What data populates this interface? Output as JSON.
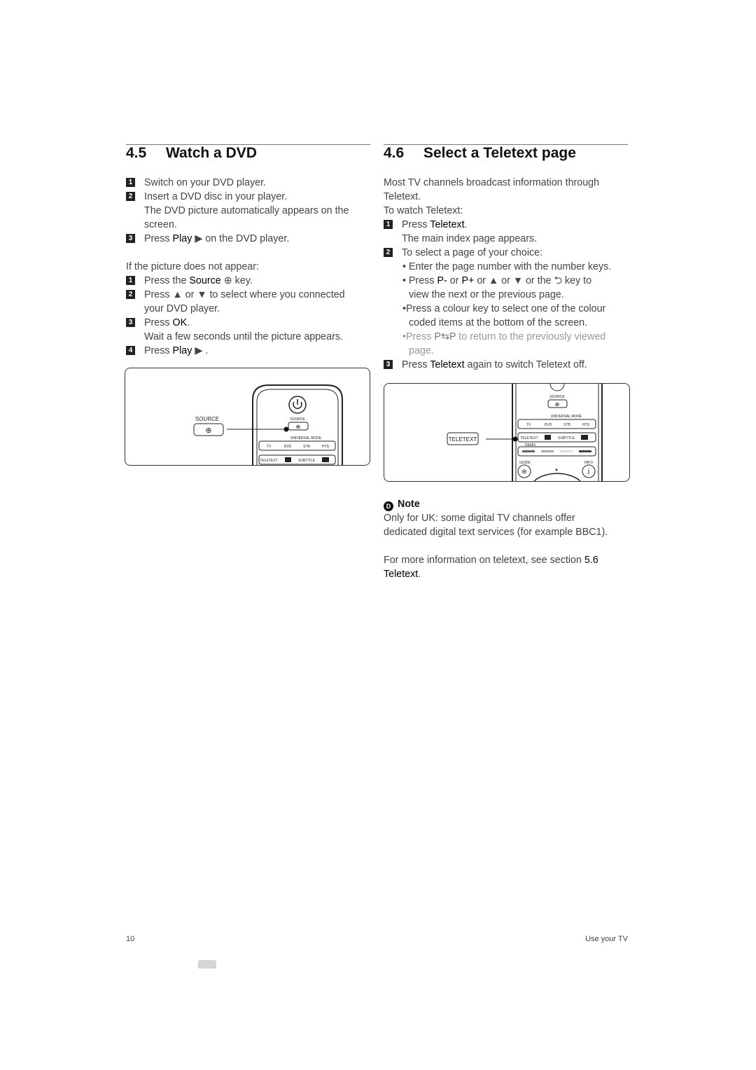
{
  "left": {
    "heading_num": "4.5",
    "heading": "Watch a DVD",
    "s1": "Switch on your DVD player.",
    "s2": "Insert a DVD disc in your player.",
    "s2b": "The DVD picture automatically appears on the",
    "s2c": "screen.",
    "s3a": "Press ",
    "s3b": "Play",
    "s3c": "▶ on the DVD player.",
    "intro": "If the picture does not appear:",
    "t1a": "Press the ",
    "t1b": "Source",
    "t1c": "⊕ key.",
    "t2": "Press ▲ or ▼ to select where you connected",
    "t2b": "your DVD player.",
    "t3a": "Press ",
    "t3b": "OK",
    ".": ".",
    "t3c": "Wait a few seconds until the picture appears.",
    "t4a": "Press ",
    "t4b": "Play",
    "t4c": "▶ .",
    "figure": {
      "source": "SOURCE",
      "universal": "UNIVERSAL MODE",
      "tv": "TV",
      "dvd": "DVD",
      "stb": "STB",
      "hts": "HTS",
      "teletext": "TELETEXT",
      "subtitle": "SUBTITLE"
    }
  },
  "right": {
    "heading_num": "4.6",
    "heading": "Select a Teletext page",
    "p1": "Most TV channels broadcast information through",
    "p2": "Teletext.",
    "p3": "To watch Teletext:",
    "s1a": "Press ",
    "s1b": "Teletext",
    "s1c": ".",
    "s1d": "The main index page appears.",
    "s2": "To select a page of your choice:",
    "b1": "• Enter the page number with the number keys.",
    "b2a": "• Press ",
    "b2b": "P-",
    "b2c": " or ",
    "b2d": "P+",
    "b2e": " or ▲  or ▼  or the ⮌ key  to",
    "b2f": "view the next or the previous page.",
    "b3": "•Press a colour key to select one of the colour",
    "b3b": "coded items at the bottom of the screen.",
    "b4a": "•Press ",
    "b4b": "P⇆P",
    "b4c": " to return to the previously viewed",
    "b4d": "page.",
    "s3a": "Press ",
    "s3b": "Teletext",
    "s3c": " again to switch Teletext off.",
    "note_title": "Note",
    "note1": "Only for UK: some digital TV channels offer",
    "note2": "dedicated digital text services (for example BBC1).",
    "more1": "For more information on teletext, see section ",
    "more_sec": "5.6",
    "more2": "Teletext",
    ".": ".",
    "figure": {
      "source": "SOURCE",
      "universal": "UNIVERSAL MODE",
      "tv": "TV",
      "dvd": "DVD",
      "stb": "STB",
      "hts": "HTS",
      "teletext": "TELETEXT",
      "subtitle": "SUBTITLE",
      "demo": "DEMO",
      "guide": "GUIDE",
      "info": "INFO"
    }
  },
  "footer": {
    "page": "10",
    "section": "Use your TV"
  },
  "colors": {
    "text": "#444444",
    "heading": "#111111",
    "muted": "#999999"
  }
}
